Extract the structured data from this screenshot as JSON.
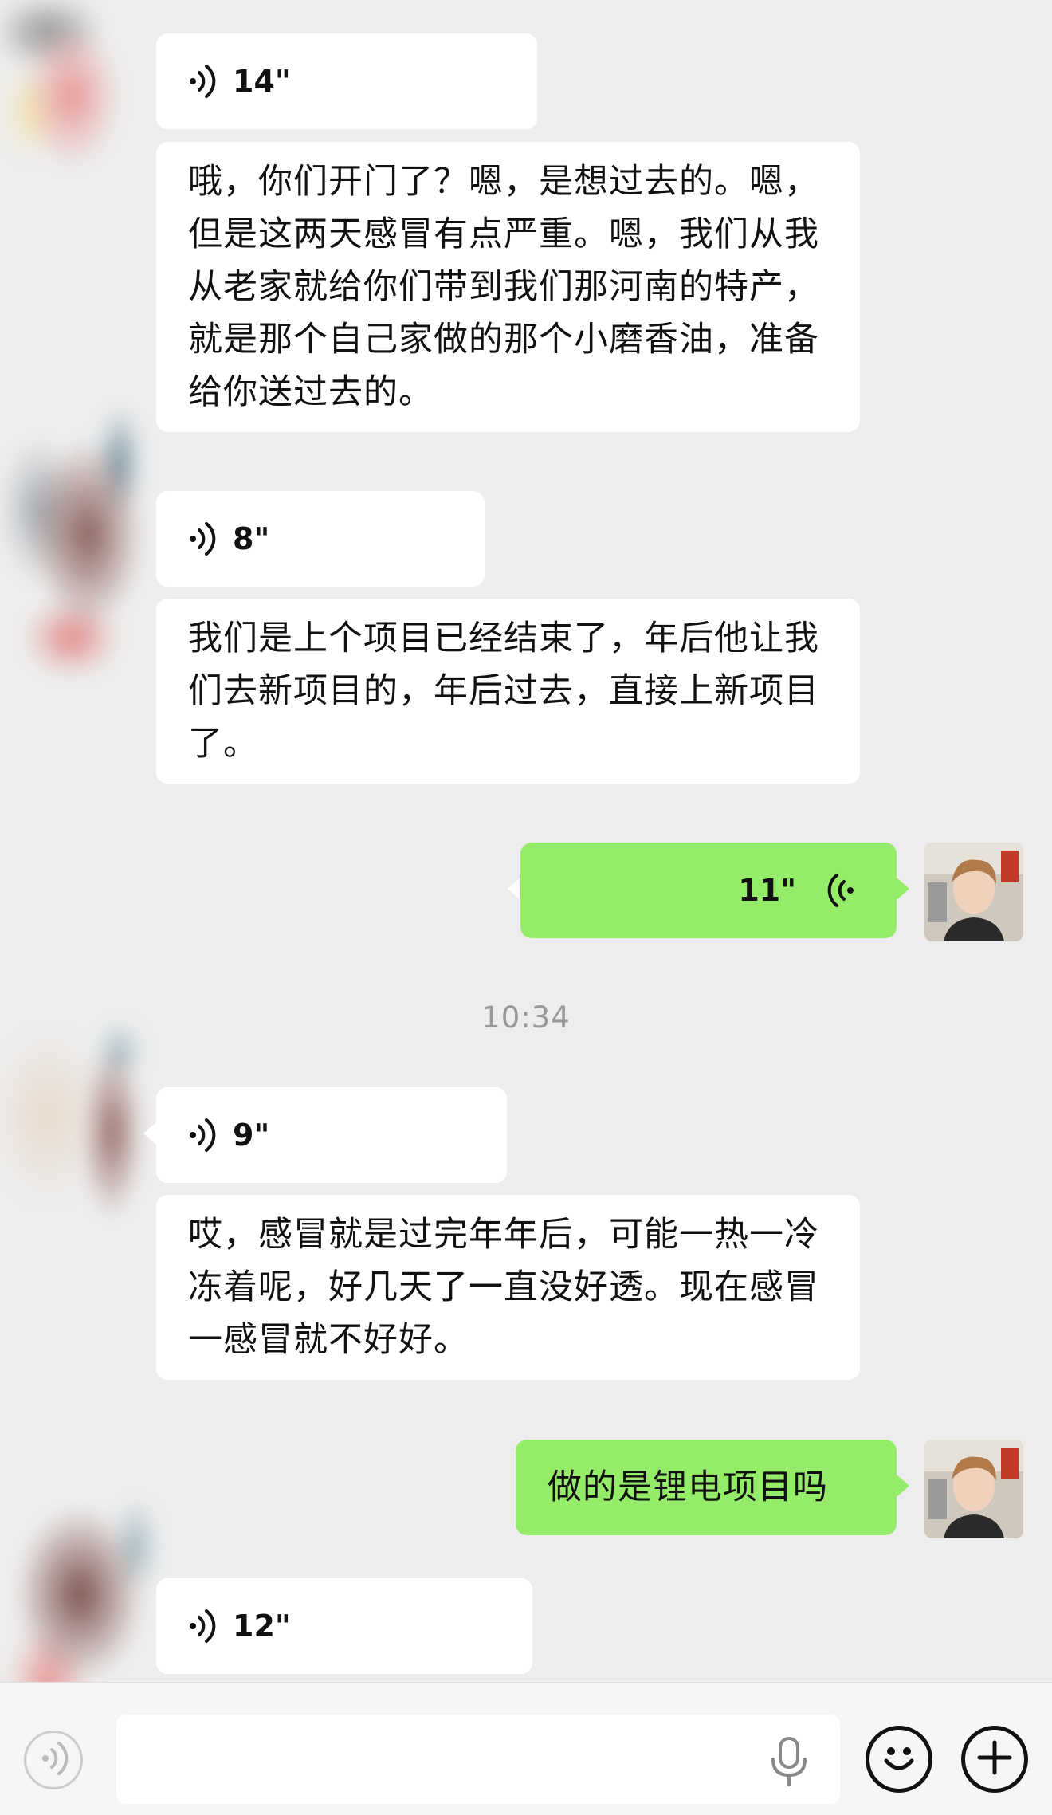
{
  "messages": [
    {
      "type": "voice",
      "side": "left",
      "duration": "14\""
    },
    {
      "type": "text",
      "side": "left",
      "text": "哦，你们开门了？嗯，是想过去的。嗯，但是这两天感冒有点严重。嗯，我们从我从老家就给你们带到我们那河南的特产，就是那个自己家做的那个小磨香油，准备给你送过去的。"
    },
    {
      "type": "voice",
      "side": "left",
      "duration": "8\""
    },
    {
      "type": "text",
      "side": "left",
      "text": "我们是上个项目已经结束了，年后他让我们去新项目的，年后过去，直接上新项目了。"
    },
    {
      "type": "voice",
      "side": "right",
      "duration": "11\""
    },
    {
      "type": "voice",
      "side": "left",
      "duration": "9\""
    },
    {
      "type": "text",
      "side": "left",
      "text": "哎，感冒就是过完年年后，可能一热一冷冻着呢，好几天了一直没好透。现在感冒一感冒就不好好。"
    },
    {
      "type": "text",
      "side": "right",
      "text": "做的是锂电项目吗"
    },
    {
      "type": "voice",
      "side": "left",
      "duration": "12\""
    }
  ],
  "timestamp": "10:34",
  "input_bar": {
    "placeholder": "",
    "voice_toggle_icon": "voice-wave-icon",
    "mic_icon": "microphone-icon",
    "emoji_icon": "smiley-icon",
    "plus_icon": "plus-icon"
  },
  "colors": {
    "background": "#ededed",
    "bubble_left": "#ffffff",
    "bubble_right": "#95ec69",
    "timestamp": "#999999"
  }
}
